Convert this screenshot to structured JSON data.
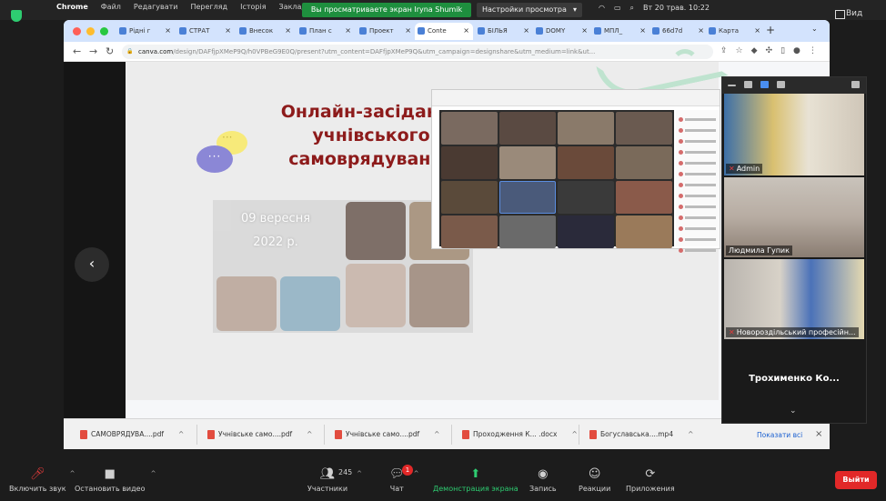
{
  "menubar": {
    "app": "Chrome",
    "items": [
      "Файл",
      "Редагувати",
      "Перегляд",
      "Історія",
      "Заклад"
    ],
    "share_banner": "Вы просматриваете экран Iryna Shumik",
    "view_options": "Настройки просмотра",
    "clock": "Вт 20 трав. 10:22",
    "view_button": "Вид"
  },
  "browser": {
    "tabs": [
      {
        "label": "Рідні г"
      },
      {
        "label": "СТРАТ"
      },
      {
        "label": "Внесок"
      },
      {
        "label": "План с"
      },
      {
        "label": "Проект"
      },
      {
        "label": "Conte"
      },
      {
        "label": "БІЛЬЯ"
      },
      {
        "label": "DOMY"
      },
      {
        "label": "МПЛ_"
      },
      {
        "label": "66d7d"
      },
      {
        "label": "Карта"
      }
    ],
    "address": {
      "url": "canva.com",
      "rest": "/design/DAFfjpXMeP9Q/h0VPBeG9E0Q/present?utm_content=DAFfjpXMeP9Q&utm_campaign=designshare&utm_medium=link&ut..."
    }
  },
  "slide": {
    "title_lines": [
      "Онлайн-засідання",
      "учнівського",
      "самоврядування"
    ],
    "bubble_dots": "···",
    "collage_date_lines": [
      "09 вересня",
      "2022 р."
    ],
    "prev_arrow": "‹"
  },
  "downloads": {
    "items": [
      {
        "label": "САМОВРЯДУВА....pdf"
      },
      {
        "label": "Учнівське само....pdf"
      },
      {
        "label": "Учнівське само....pdf"
      },
      {
        "label": "Проходження К... .docx"
      },
      {
        "label": "Богуславська....mp4"
      }
    ],
    "show_all": "Показати всі"
  },
  "participants": {
    "videos": [
      {
        "name": "Admin"
      },
      {
        "name": "Людмила Гупик"
      },
      {
        "name": "Новороздільський професійн..."
      }
    ],
    "name_tile": "Трохименко Ко..."
  },
  "toolbar": {
    "unmute": "Включить звук",
    "stop_video": "Остановить видео",
    "participants": "Участники",
    "participants_count": "245",
    "chat": "Чат",
    "chat_badge": "1",
    "share_screen": "Демонстрация экрана",
    "record": "Запись",
    "reactions": "Реакции",
    "apps": "Приложения",
    "leave": "Выйти"
  },
  "colors": {
    "title": "#8d1b1b",
    "share_green": "#1e8f3e",
    "leave_red": "#e22828",
    "tabstrip": "#d3e3fd"
  }
}
